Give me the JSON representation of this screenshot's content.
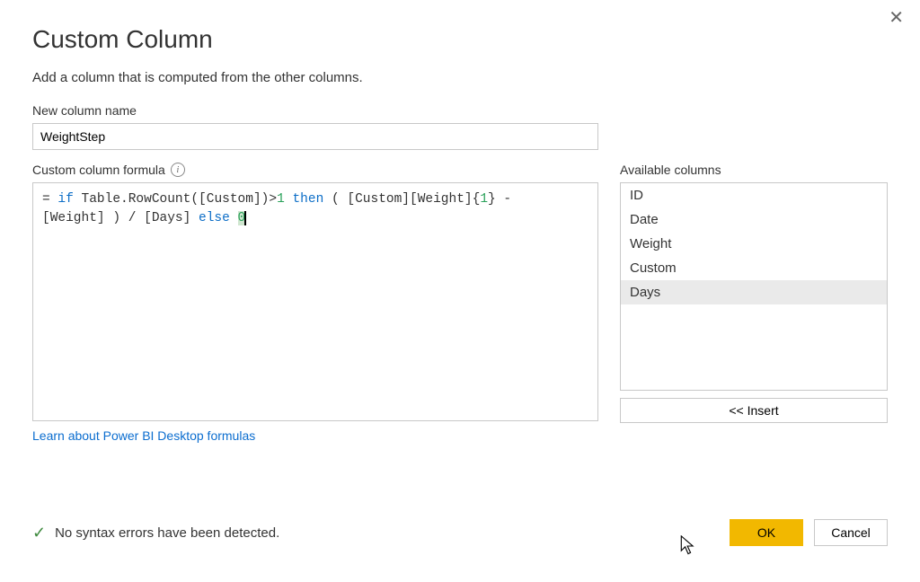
{
  "dialog": {
    "title": "Custom Column",
    "subtitle": "Add a column that is computed from the other columns."
  },
  "name_field": {
    "label": "New column name",
    "value": "WeightStep"
  },
  "formula": {
    "label": "Custom column formula",
    "prefix": "= ",
    "tokens": [
      {
        "t": "kw",
        "v": "if"
      },
      {
        "t": "p",
        "v": " Table.RowCount([Custom])>"
      },
      {
        "t": "num",
        "v": "1"
      },
      {
        "t": "p",
        "v": " "
      },
      {
        "t": "kw",
        "v": "then"
      },
      {
        "t": "p",
        "v": " ( [Custom][Weight]{"
      },
      {
        "t": "num",
        "v": "1"
      },
      {
        "t": "p",
        "v": "} -\n  [Weight] ) / [Days] "
      },
      {
        "t": "kw",
        "v": "else"
      },
      {
        "t": "p",
        "v": " "
      },
      {
        "t": "car",
        "v": "0"
      }
    ]
  },
  "available": {
    "label": "Available columns",
    "items": [
      "ID",
      "Date",
      "Weight",
      "Custom",
      "Days"
    ],
    "selected_index": 4
  },
  "insert_button": "<< Insert",
  "learn_link": "Learn about Power BI Desktop formulas",
  "status": {
    "text": "No syntax errors have been detected."
  },
  "buttons": {
    "ok": "OK",
    "cancel": "Cancel"
  }
}
